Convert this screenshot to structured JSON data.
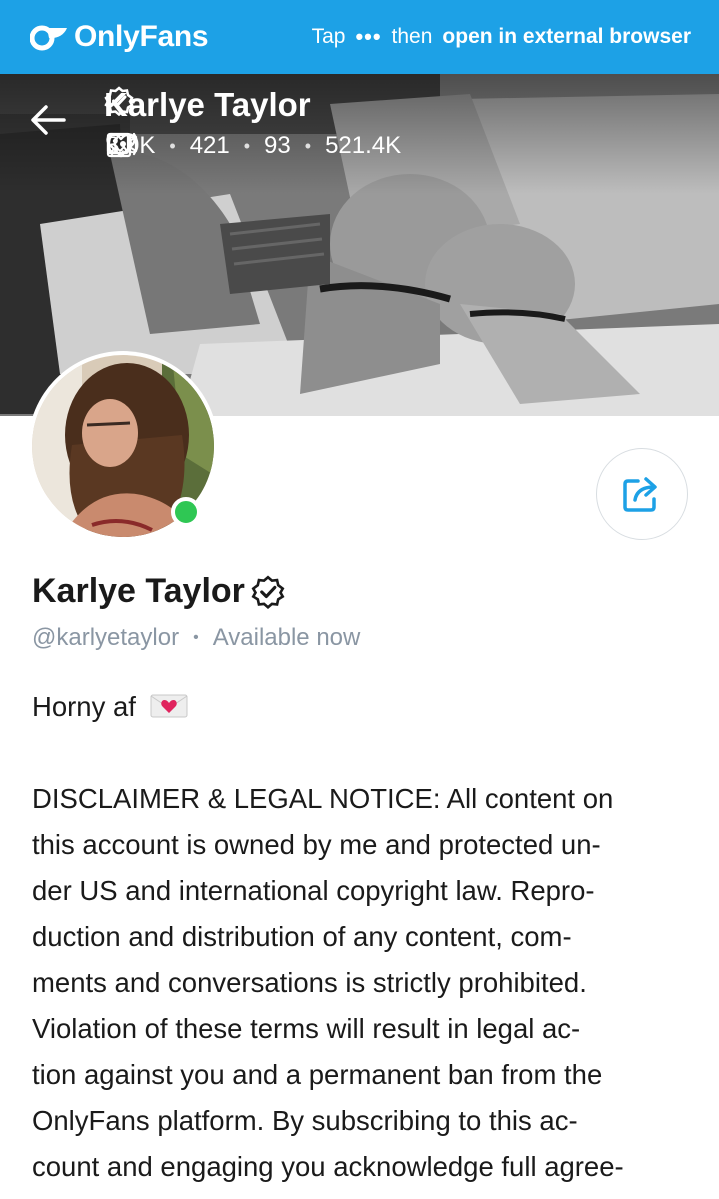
{
  "topbar": {
    "logo_text": "OnlyFans",
    "tap_label": "Tap",
    "dots": "•••",
    "then_label": "then",
    "open_label": "open in external browser",
    "bg_color": "#1da1e6"
  },
  "cover": {
    "display_name": "Karlye Taylor",
    "stats": {
      "photos": "3.0K",
      "videos": "421",
      "streams": "93",
      "likes": "521.4K"
    },
    "icons": [
      "back-arrow-icon",
      "image-icon",
      "video-icon",
      "broadcast-icon",
      "heart-icon",
      "verified-icon"
    ]
  },
  "profile": {
    "name": "Karlye Taylor",
    "handle": "@karlyetaylor",
    "separator": "•",
    "availability": "Available now",
    "online_color": "#2fc754"
  },
  "bio": {
    "line1": "Horny af",
    "emoji": "love-letter-icon",
    "lines": [
      "DISCLAIMER & LEGAL NOTICE: All content on",
      "this account is owned by me and protected un-",
      "der US and international copyright law. Repro-",
      "duction and distribution of any content, com-",
      "ments and conversations is strictly prohibited.",
      "Violation of these terms will result in legal ac-",
      "tion against you and a permanent ban from the",
      "OnlyFans platform. By subscribing to this ac-",
      "count and engaging you acknowledge full agree-"
    ]
  }
}
